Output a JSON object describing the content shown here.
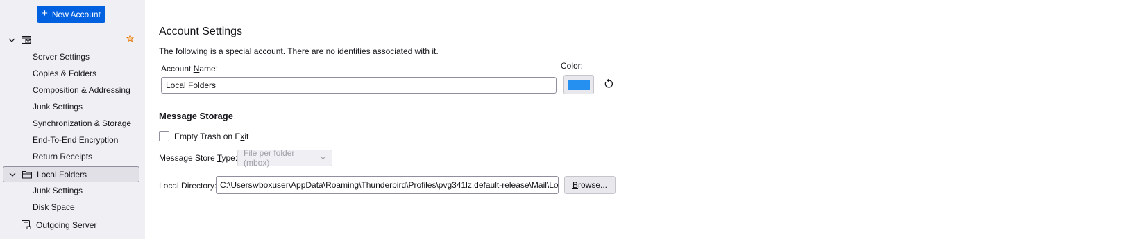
{
  "sidebar": {
    "new_account": {
      "icon": "plus-icon",
      "label": "New Account"
    },
    "account1": {
      "icon": "account-icon",
      "star_icon": "star-icon",
      "items": [
        "Server Settings",
        "Copies & Folders",
        "Composition & Addressing",
        "Junk Settings",
        "Synchronization & Storage",
        "End-To-End Encryption",
        "Return Receipts"
      ]
    },
    "local_folders": {
      "label": "Local Folders",
      "icon": "folder-icon",
      "items": [
        "Junk Settings",
        "Disk Space"
      ]
    },
    "outgoing_server": {
      "label": "Outgoing Server",
      "icon": "outgoing-server-icon"
    }
  },
  "main": {
    "title": "Account Settings",
    "description": "The following is a special account. There are no identities associated with it.",
    "account_name_label_pre": "Account ",
    "account_name_label_key": "N",
    "account_name_label_post": "ame:",
    "account_name_value": "Local Folders",
    "color_label": "Color:",
    "color_value": "#2590f0",
    "reset_icon": "reset-color-icon",
    "message_storage_heading": "Message Storage",
    "empty_trash_pre": "Empty Trash on E",
    "empty_trash_key": "x",
    "empty_trash_post": "it",
    "empty_trash_checked": false,
    "store_type_label_pre": "Message Store ",
    "store_type_label_key": "T",
    "store_type_label_post": "ype:",
    "store_type_value": "File per folder (mbox)",
    "local_directory_label": "Local Directory:",
    "local_directory_value": "C:\\Users\\vboxuser\\AppData\\Roaming\\Thunderbird\\Profiles\\pvg341lz.default-release\\Mail\\Local Folders",
    "browse_pre": "",
    "browse_key": "B",
    "browse_post": "rowse..."
  }
}
